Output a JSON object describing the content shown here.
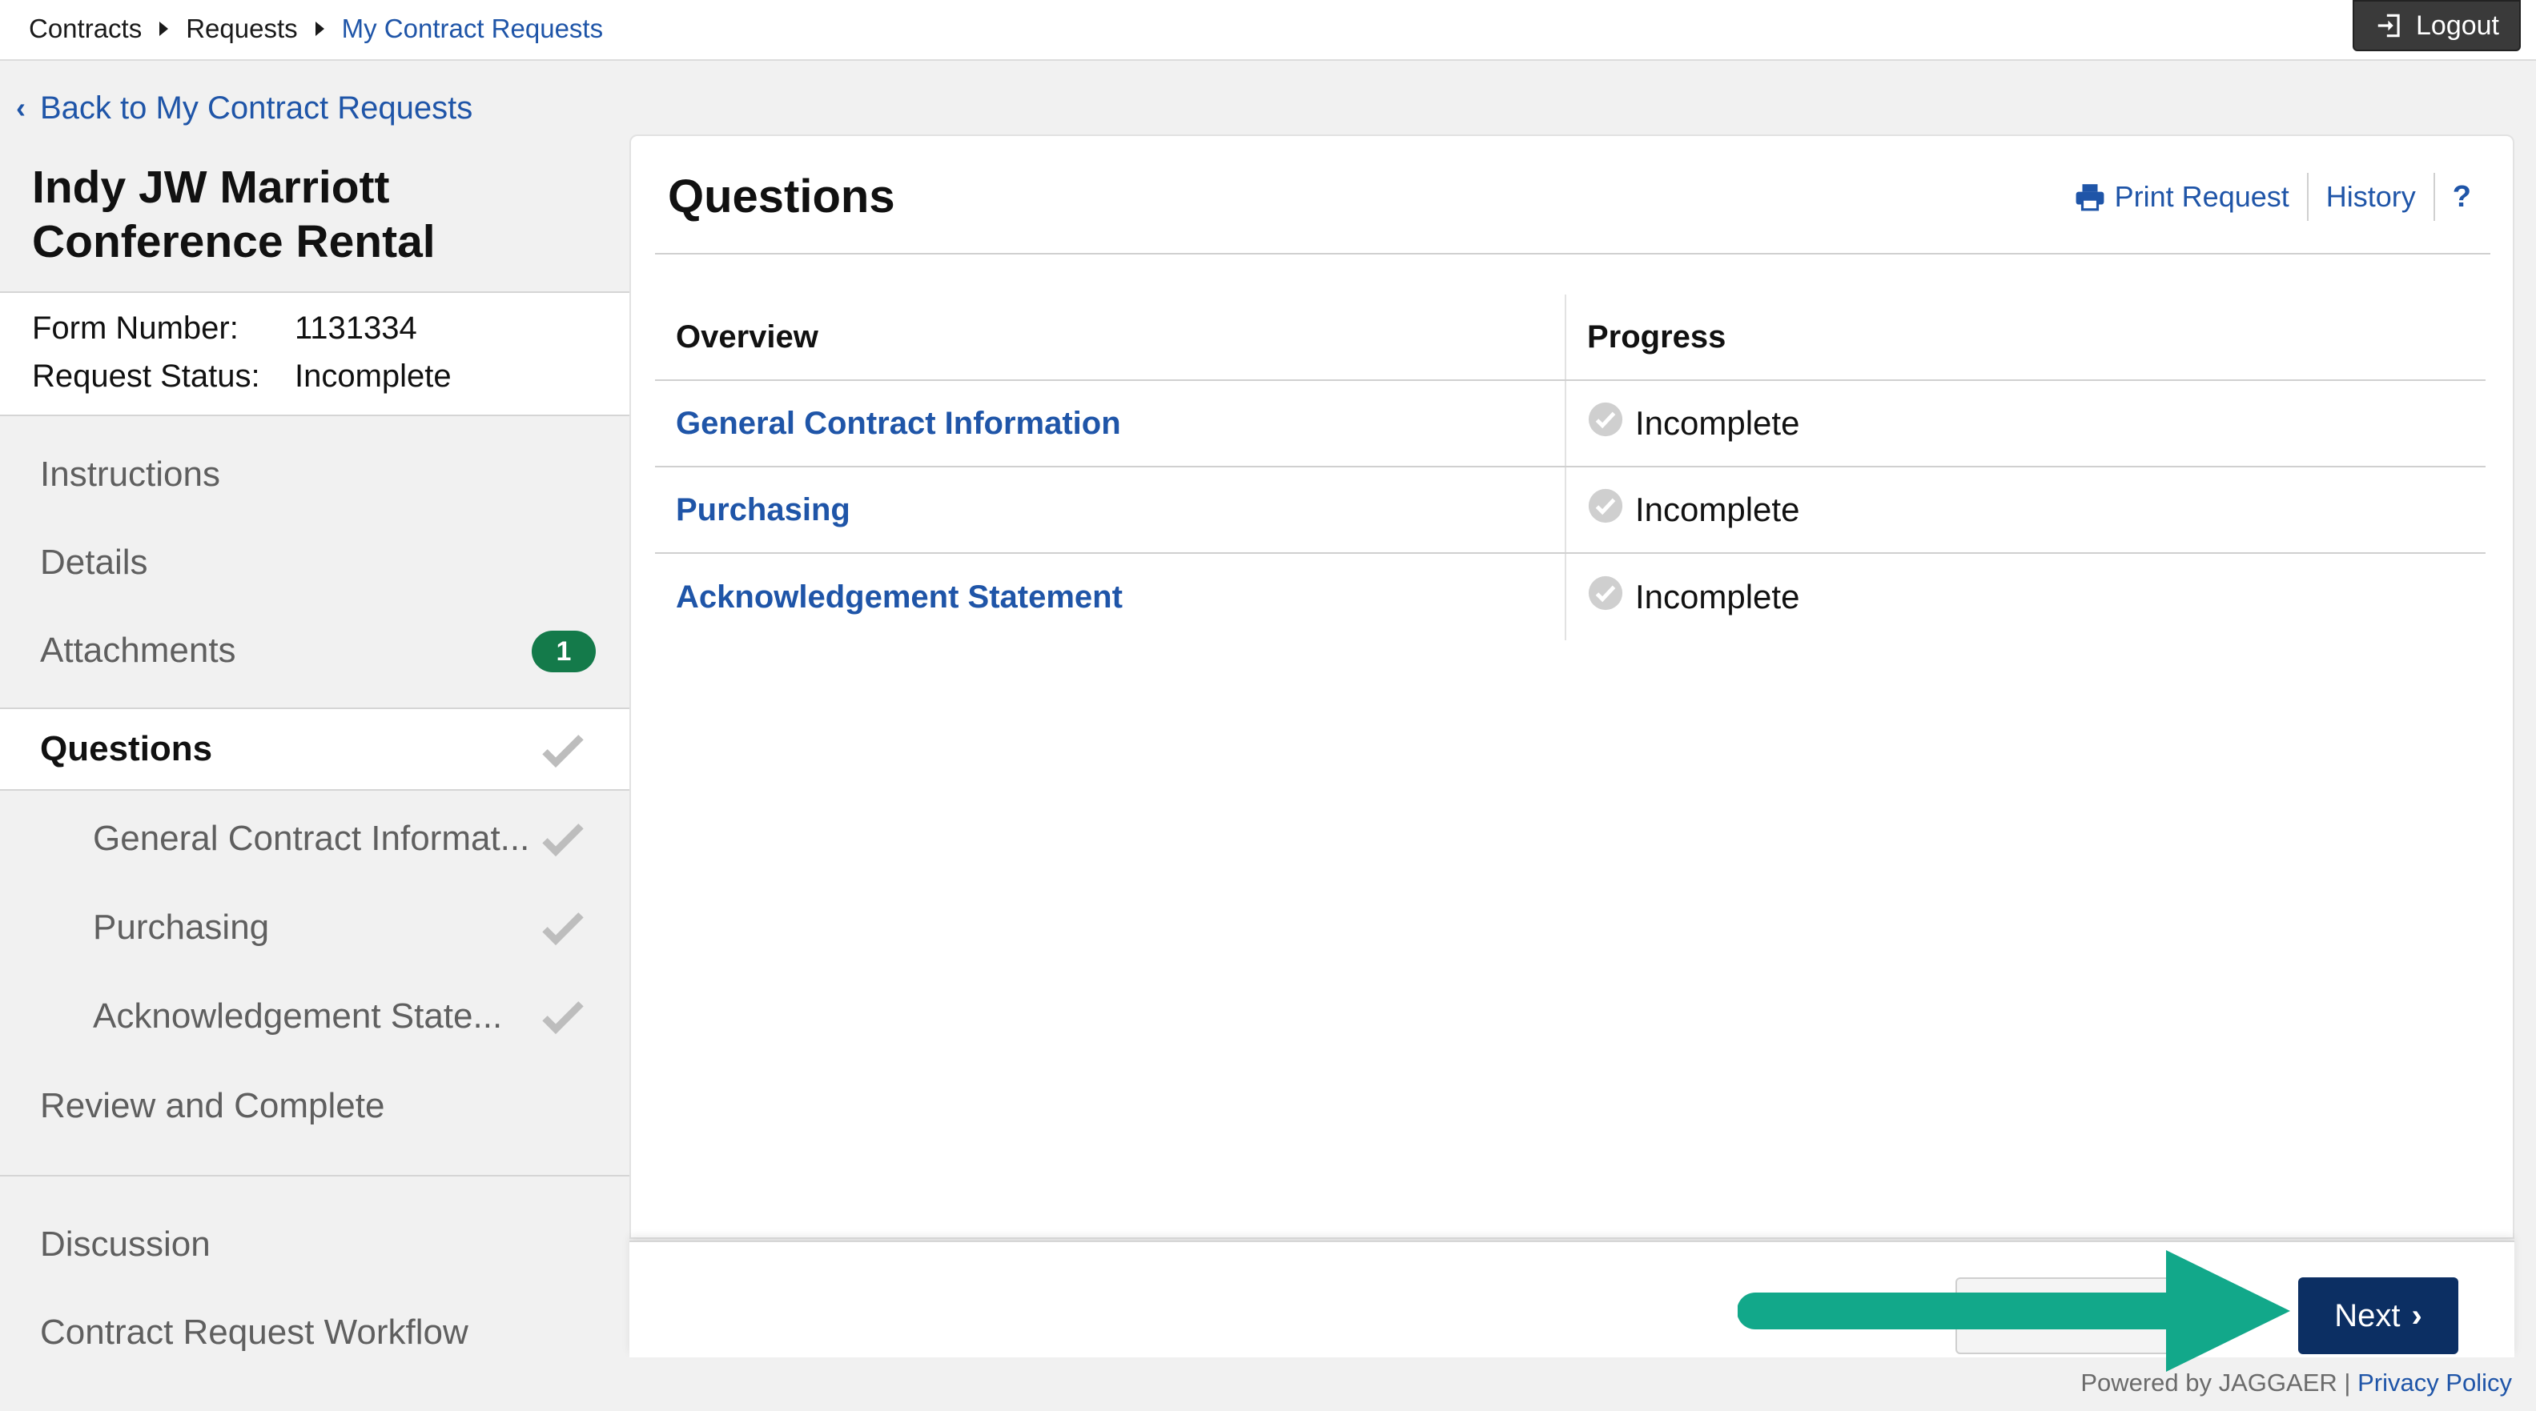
{
  "breadcrumb": {
    "items": [
      "Contracts",
      "Requests"
    ],
    "current": "My Contract Requests"
  },
  "header": {
    "logout_label": "Logout"
  },
  "back_link": {
    "label": "Back to My Contract Requests"
  },
  "request": {
    "title": "Indy JW Marriott Conference Rental",
    "form_number_label": "Form Number:",
    "form_number": "1131334",
    "status_label": "Request Status:",
    "status": "Incomplete"
  },
  "sidebar": {
    "items": [
      {
        "label": "Instructions"
      },
      {
        "label": "Details"
      },
      {
        "label": "Attachments",
        "badge": "1"
      },
      {
        "label": "Questions"
      },
      {
        "label": "General Contract Informat..."
      },
      {
        "label": "Purchasing"
      },
      {
        "label": "Acknowledgement State..."
      },
      {
        "label": "Review and Complete"
      },
      {
        "label": "Discussion"
      },
      {
        "label": "Contract Request Workflow"
      }
    ]
  },
  "main": {
    "title": "Questions",
    "actions": {
      "print": "Print Request",
      "history": "History",
      "help": "?"
    },
    "table": {
      "headers": [
        "Overview",
        "Progress"
      ],
      "rows": [
        {
          "section": "General Contract Information",
          "progress": "Incomplete"
        },
        {
          "section": "Purchasing",
          "progress": "Incomplete"
        },
        {
          "section": "Acknowledgement Statement",
          "progress": "Incomplete"
        }
      ]
    }
  },
  "footer": {
    "next_label": "Next",
    "powered_by": "Powered by JAGGAER |",
    "privacy": "Privacy Policy"
  },
  "colors": {
    "link": "#1f55a8",
    "primary_button": "#0c2f63",
    "badge": "#147a4a",
    "annotation_arrow": "#12a88a"
  }
}
